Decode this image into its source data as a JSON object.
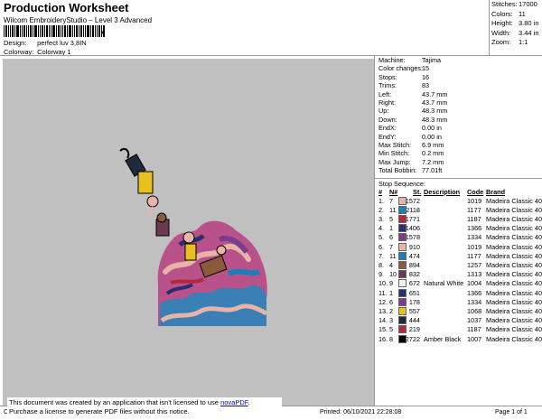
{
  "header": {
    "title": "Production Worksheet",
    "subtitle": "Wilcom EmbroideryStudio – Level 3 Advanced",
    "barcode_suffix": ",",
    "design_label": "Design:",
    "design_value": "perfect luv 3,8IN",
    "colorway_label": "Colorway:",
    "colorway_value": "Colorway 1"
  },
  "summary": {
    "stitches_label": "Stitches:",
    "stitches_value": "17000",
    "colors_label": "Colors:",
    "colors_value": "11",
    "height_label": "Height:",
    "height_value": "3.80 in",
    "width_label": "Width:",
    "width_value": "3.44 in",
    "zoom_label": "Zoom:",
    "zoom_value": "1:1"
  },
  "machine": [
    {
      "k": "Machine:",
      "v": "Tajima"
    },
    {
      "k": "Color changes:",
      "v": "15"
    },
    {
      "k": "Stops:",
      "v": "16"
    },
    {
      "k": "Trims:",
      "v": "83"
    },
    {
      "k": "Left:",
      "v": "43.7 mm"
    },
    {
      "k": "Right:",
      "v": "43.7 mm"
    },
    {
      "k": "Up:",
      "v": "48.3 mm"
    },
    {
      "k": "Down:",
      "v": "48.3 mm"
    },
    {
      "k": "EndX:",
      "v": "0.00 in"
    },
    {
      "k": "EndY:",
      "v": "0.00 in"
    },
    {
      "k": "Max Stitch:",
      "v": "6.9 mm"
    },
    {
      "k": "Min Stitch:",
      "v": "0.2 mm"
    },
    {
      "k": "Max Jump:",
      "v": "7.2 mm"
    },
    {
      "k": "Total Bobbin:",
      "v": "77.01ft"
    }
  ],
  "stop_sequence": {
    "heading": "Stop Sequence:",
    "columns": {
      "num": "#",
      "n": "N#",
      "st": "St.",
      "desc": "Description",
      "code": "Code",
      "brand": "Brand"
    },
    "rows": [
      {
        "num": "1.",
        "n": "7",
        "color": "#e8b4a8",
        "st": "1572",
        "desc": "",
        "code": "1019",
        "brand": "Madeira Classic 40"
      },
      {
        "num": "2.",
        "n": "11",
        "color": "#1e7fb8",
        "st": "2118",
        "desc": "",
        "code": "1177",
        "brand": "Madeira Classic 40"
      },
      {
        "num": "3.",
        "n": "5",
        "color": "#b4283c",
        "st": "1771",
        "desc": "",
        "code": "1187",
        "brand": "Madeira Classic 40"
      },
      {
        "num": "4.",
        "n": "1",
        "color": "#2a2d6e",
        "st": "1406",
        "desc": "",
        "code": "1366",
        "brand": "Madeira Classic 40"
      },
      {
        "num": "5.",
        "n": "6",
        "color": "#7a3c8c",
        "st": "1578",
        "desc": "",
        "code": "1334",
        "brand": "Madeira Classic 40"
      },
      {
        "num": "6.",
        "n": "7",
        "color": "#e8b4a8",
        "st": "910",
        "desc": "",
        "code": "1019",
        "brand": "Madeira Classic 40"
      },
      {
        "num": "7.",
        "n": "11",
        "color": "#1e7fb8",
        "st": "474",
        "desc": "",
        "code": "1177",
        "brand": "Madeira Classic 40"
      },
      {
        "num": "8.",
        "n": "4",
        "color": "#8a5a3a",
        "st": "894",
        "desc": "",
        "code": "1257",
        "brand": "Madeira Classic 40"
      },
      {
        "num": "9.",
        "n": "10",
        "color": "#6a3a50",
        "st": "832",
        "desc": "",
        "code": "1313",
        "brand": "Madeira Classic 40"
      },
      {
        "num": "10.",
        "n": "9",
        "color": "#f4f0e6",
        "st": "672",
        "desc": "Natural White",
        "code": "1004",
        "brand": "Madeira Classic 40"
      },
      {
        "num": "11.",
        "n": "1",
        "color": "#2a2d6e",
        "st": "651",
        "desc": "",
        "code": "1366",
        "brand": "Madeira Classic 40"
      },
      {
        "num": "12.",
        "n": "6",
        "color": "#7a3c8c",
        "st": "178",
        "desc": "",
        "code": "1334",
        "brand": "Madeira Classic 40"
      },
      {
        "num": "13.",
        "n": "2",
        "color": "#e8c020",
        "st": "557",
        "desc": "",
        "code": "1068",
        "brand": "Madeira Classic 40"
      },
      {
        "num": "14.",
        "n": "3",
        "color": "#1e2a3a",
        "st": "444",
        "desc": "",
        "code": "1037",
        "brand": "Madeira Classic 40"
      },
      {
        "num": "15.",
        "n": "5",
        "color": "#b4283c",
        "st": "219",
        "desc": "",
        "code": "1187",
        "brand": "Madeira Classic 40"
      },
      {
        "num": "16.",
        "n": "8",
        "color": "#000000",
        "st": "2722",
        "desc": "Amber Black",
        "code": "1007",
        "brand": "Madeira Classic 40"
      }
    ]
  },
  "footer": {
    "left": "Cr",
    "printed": "Printed: 06/10/2021 22:28:08",
    "page": "Page 1 of 1"
  },
  "notice": {
    "line1_pre": "This document was created by an application that isn't licensed to use ",
    "link": "novaPDF",
    "line1_post": ".",
    "line2": "Purchase a license to generate PDF files without this notice."
  }
}
